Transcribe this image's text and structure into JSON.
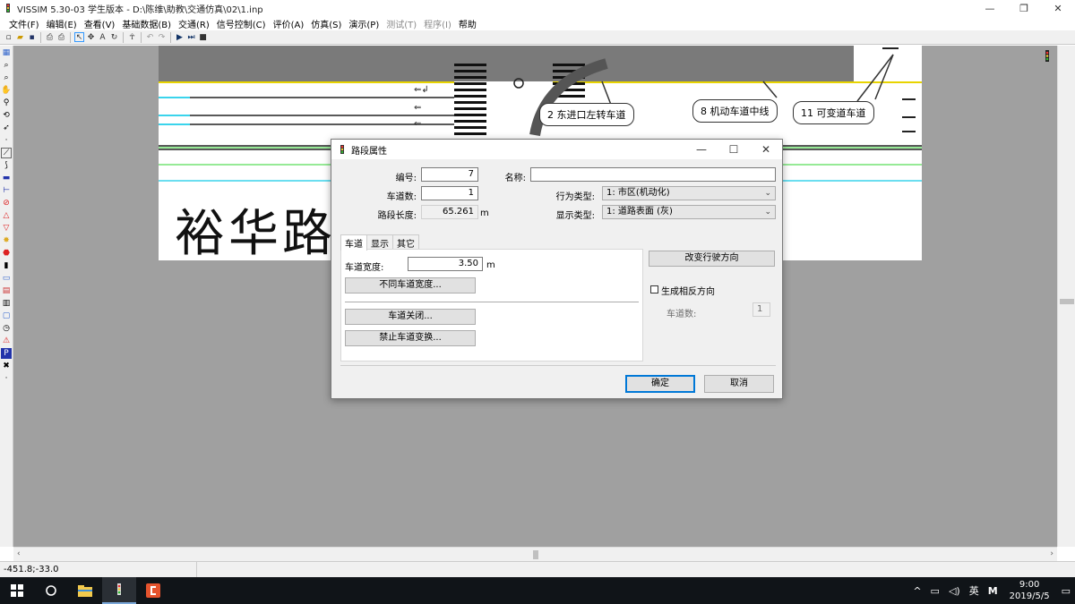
{
  "window": {
    "title": "VISSIM 5.30-03 学生版本 - D:\\陈维\\助教\\交通仿真\\02\\1.inp",
    "minimize": "—",
    "maximize": "❐",
    "close": "✕"
  },
  "menu": [
    {
      "label": "文件(F)",
      "enabled": true
    },
    {
      "label": "编辑(E)",
      "enabled": true
    },
    {
      "label": "查看(V)",
      "enabled": true
    },
    {
      "label": "基础数据(B)",
      "enabled": true
    },
    {
      "label": "交通(R)",
      "enabled": true
    },
    {
      "label": "信号控制(C)",
      "enabled": true
    },
    {
      "label": "评价(A)",
      "enabled": true
    },
    {
      "label": "仿真(S)",
      "enabled": true
    },
    {
      "label": "演示(P)",
      "enabled": true
    },
    {
      "label": "测试(T)",
      "enabled": false
    },
    {
      "label": "程序(I)",
      "enabled": false
    },
    {
      "label": "帮助",
      "enabled": true
    }
  ],
  "drawing": {
    "road_name": "裕华路",
    "callouts": {
      "c1": "2 东进口左转车道",
      "c2": "8 机动车道中线",
      "c3": "11 可变道车道"
    }
  },
  "dialog": {
    "title": "路段属性",
    "fields": {
      "number_label": "编号:",
      "number_value": "7",
      "name_label": "名称:",
      "name_value": "",
      "lanes_label": "车道数:",
      "lanes_value": "1",
      "length_label": "路段长度:",
      "length_value": "65.261",
      "length_unit": "m",
      "behavior_label": "行为类型:",
      "behavior_value": "1: 市区(机动化)",
      "display_label": "显示类型:",
      "display_value": "1: 道路表面 (灰)"
    },
    "tabs": [
      "车道",
      "显示",
      "其它"
    ],
    "lane_tab": {
      "width_label": "车道宽度:",
      "width_value": "3.50",
      "width_unit": "m",
      "diff_width_button": "不同车道宽度...",
      "lane_close_button": "车道关闭...",
      "no_lane_change_button": "禁止车道变换..."
    },
    "right_panel": {
      "reverse_direction_button": "改变行驶方向",
      "generate_opposite_label": "生成相反方向",
      "generate_opposite_checked": false,
      "opposite_lanes_label": "车道数:",
      "opposite_lanes_value": "1"
    },
    "ok_button": "确定",
    "cancel_button": "取消"
  },
  "status": {
    "coordinates": "-451.8;-33.0"
  },
  "taskbar": {
    "tray_chevron": "^",
    "tray_ime": "英",
    "tray_m": "M",
    "time": "9:00",
    "date": "2019/5/5"
  }
}
